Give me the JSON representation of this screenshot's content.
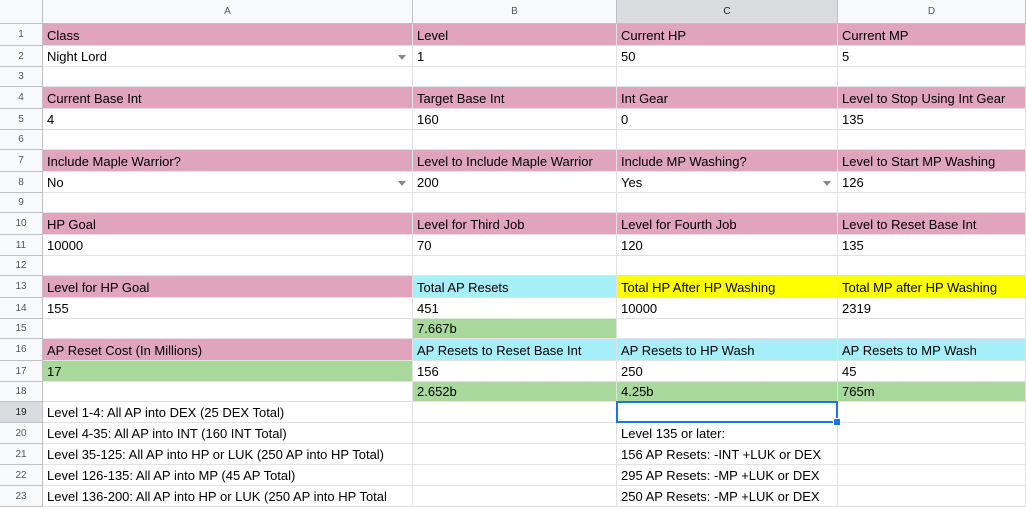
{
  "columns": [
    "A",
    "B",
    "C",
    "D"
  ],
  "rows": [
    "1",
    "2",
    "3",
    "4",
    "5",
    "6",
    "7",
    "8",
    "9",
    "10",
    "11",
    "12",
    "13",
    "14",
    "15",
    "16",
    "17",
    "18",
    "19",
    "20",
    "21",
    "22",
    "23"
  ],
  "selected_cell": "C19",
  "colors": {
    "pink": "#e0a4bc",
    "cyan": "#a6eef8",
    "yellow": "#ffff00",
    "green": "#a8d89c",
    "selection": "#1a73e8"
  },
  "cells": {
    "A1": "Class",
    "B1": "Level",
    "C1": "Current HP",
    "D1": "Current MP",
    "A2": "Night Lord",
    "B2": "1",
    "C2": "50",
    "D2": "5",
    "A4": "Current Base Int",
    "B4": "Target Base Int",
    "C4": "Int Gear",
    "D4": "Level to Stop Using Int Gear",
    "A5": "4",
    "B5": "160",
    "C5": "0",
    "D5": "135",
    "A7": "Include Maple Warrior?",
    "B7": "Level to Include Maple Warrior",
    "C7": "Include MP Washing?",
    "D7": "Level to Start MP Washing",
    "A8": "No",
    "B8": "200",
    "C8": "Yes",
    "D8": "126",
    "A10": "HP Goal",
    "B10": "Level for Third Job",
    "C10": "Level for Fourth Job",
    "D10": "Level to Reset Base Int",
    "A11": "10000",
    "B11": "70",
    "C11": "120",
    "D11": "135",
    "A13": "Level for HP Goal",
    "B13": "Total AP Resets",
    "C13": "Total HP After HP Washing",
    "D13": "Total MP after HP Washing",
    "A14": "155",
    "B14": "451",
    "C14": "10000",
    "D14": "2319",
    "B15": "7.667b",
    "A16": "AP Reset Cost (In Millions)",
    "B16": "AP Resets to Reset Base Int",
    "C16": "AP Resets to HP Wash",
    "D16": "AP Resets to MP Wash",
    "A17": "17",
    "B17": "156",
    "C17": "250",
    "D17": "45",
    "B18": "2.652b",
    "C18": "4.25b",
    "D18": "765m",
    "A19": "Level 1-4: All AP into DEX (25 DEX Total)",
    "A20": "Level 4-35: All AP into INT (160 INT Total)",
    "C20": "Level 135 or later:",
    "A21": "Level 35-125: All AP into HP or LUK (250 AP into HP Total)",
    "C21": "156 AP Resets: -INT +LUK or DEX",
    "A22": "Level 126-135: All AP into MP (45 AP Total)",
    "C22": "295 AP Resets: -MP +LUK or DEX",
    "A23": "Level 136-200: All AP into HP or LUK (250 AP into HP Total",
    "C23": "250 AP Resets: -MP +LUK or DEX"
  }
}
